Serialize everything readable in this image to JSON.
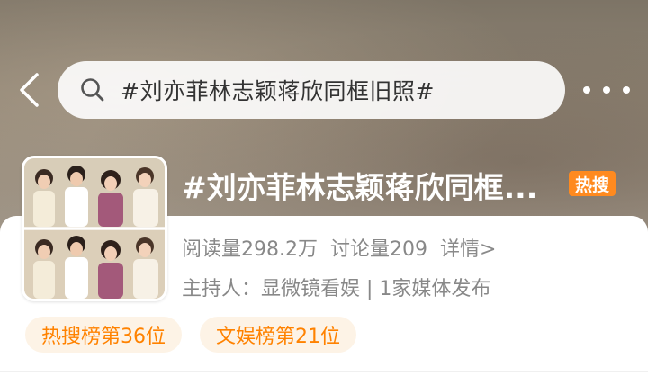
{
  "header": {
    "search_text": "#刘亦菲林志颖蒋欣同框旧照#",
    "back_icon": "chevron-left-icon",
    "more_icon": "more-dots-icon",
    "search_icon": "search-icon"
  },
  "topic": {
    "title": "#刘亦菲林志颖蒋欣同框...",
    "badge": "热搜",
    "badge_color": "#ff8a1f",
    "stats": {
      "reads": "阅读量298.2万",
      "discussions": "讨论量209",
      "detail": "详情>"
    },
    "host_line": "主持人：显微镜看娱 | 1家媒体发布"
  },
  "rank_chips": [
    {
      "label": "热搜榜第36位"
    },
    {
      "label": "文娱榜第21位"
    }
  ],
  "colors": {
    "accent_orange": "#ff8200",
    "chip_bg": "#fdf3e6"
  }
}
